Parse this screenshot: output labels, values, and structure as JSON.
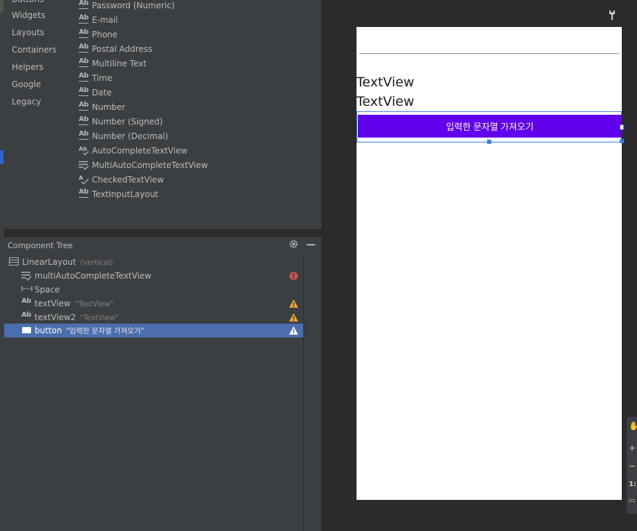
{
  "palette": {
    "categories": [
      "Widgets",
      "Layouts",
      "Containers",
      "Helpers",
      "Google",
      "Legacy"
    ],
    "items": [
      {
        "label": "Password (Numeric)",
        "icon": "ab-icon"
      },
      {
        "label": "E-mail",
        "icon": "ab-icon"
      },
      {
        "label": "Phone",
        "icon": "ab-icon"
      },
      {
        "label": "Postal Address",
        "icon": "ab-icon"
      },
      {
        "label": "Multiline Text",
        "icon": "ab-icon"
      },
      {
        "label": "Time",
        "icon": "ab-icon"
      },
      {
        "label": "Date",
        "icon": "ab-icon"
      },
      {
        "label": "Number",
        "icon": "ab-icon"
      },
      {
        "label": "Number (Signed)",
        "icon": "ab-icon"
      },
      {
        "label": "Number (Decimal)",
        "icon": "ab-icon"
      },
      {
        "label": "AutoCompleteTextView",
        "icon": "autocomplete-icon"
      },
      {
        "label": "MultiAutoCompleteTextView",
        "icon": "multiautocomplete-icon"
      },
      {
        "label": "CheckedTextView",
        "icon": "checked-text-icon"
      },
      {
        "label": "TextInputLayout",
        "icon": "ab-icon"
      }
    ]
  },
  "component_tree": {
    "title": "Component Tree",
    "rows": [
      {
        "name": "LinearLayout",
        "attr": "(vertical)",
        "icon": "linear-layout-icon",
        "status": ""
      },
      {
        "name": "multiAutoCompleteTextView",
        "attr": "",
        "icon": "multiautocomplete-icon",
        "status": "error"
      },
      {
        "name": "Space",
        "attr": "",
        "icon": "space-icon",
        "status": ""
      },
      {
        "name": "textView",
        "attr": "\"TextView\"",
        "icon": "ab-icon",
        "status": "warning"
      },
      {
        "name": "textView2",
        "attr": "\"TextView\"",
        "icon": "ab-icon",
        "status": "warning"
      },
      {
        "name": "button",
        "attr": "\"입력한 문자열 가져오기\"",
        "icon": "button-icon",
        "status": "warning",
        "selected": true
      }
    ]
  },
  "preview": {
    "textview1": "TextView",
    "textview2": "TextView",
    "button_label": "입력한 문자열 가져오기",
    "button_color": "#6200ee"
  },
  "colors": {
    "panel_bg": "#3c3f41",
    "editor_bg": "#2b2b2b",
    "selection": "#4b6eaf",
    "error": "#c75450",
    "warning": "#f0a732"
  }
}
